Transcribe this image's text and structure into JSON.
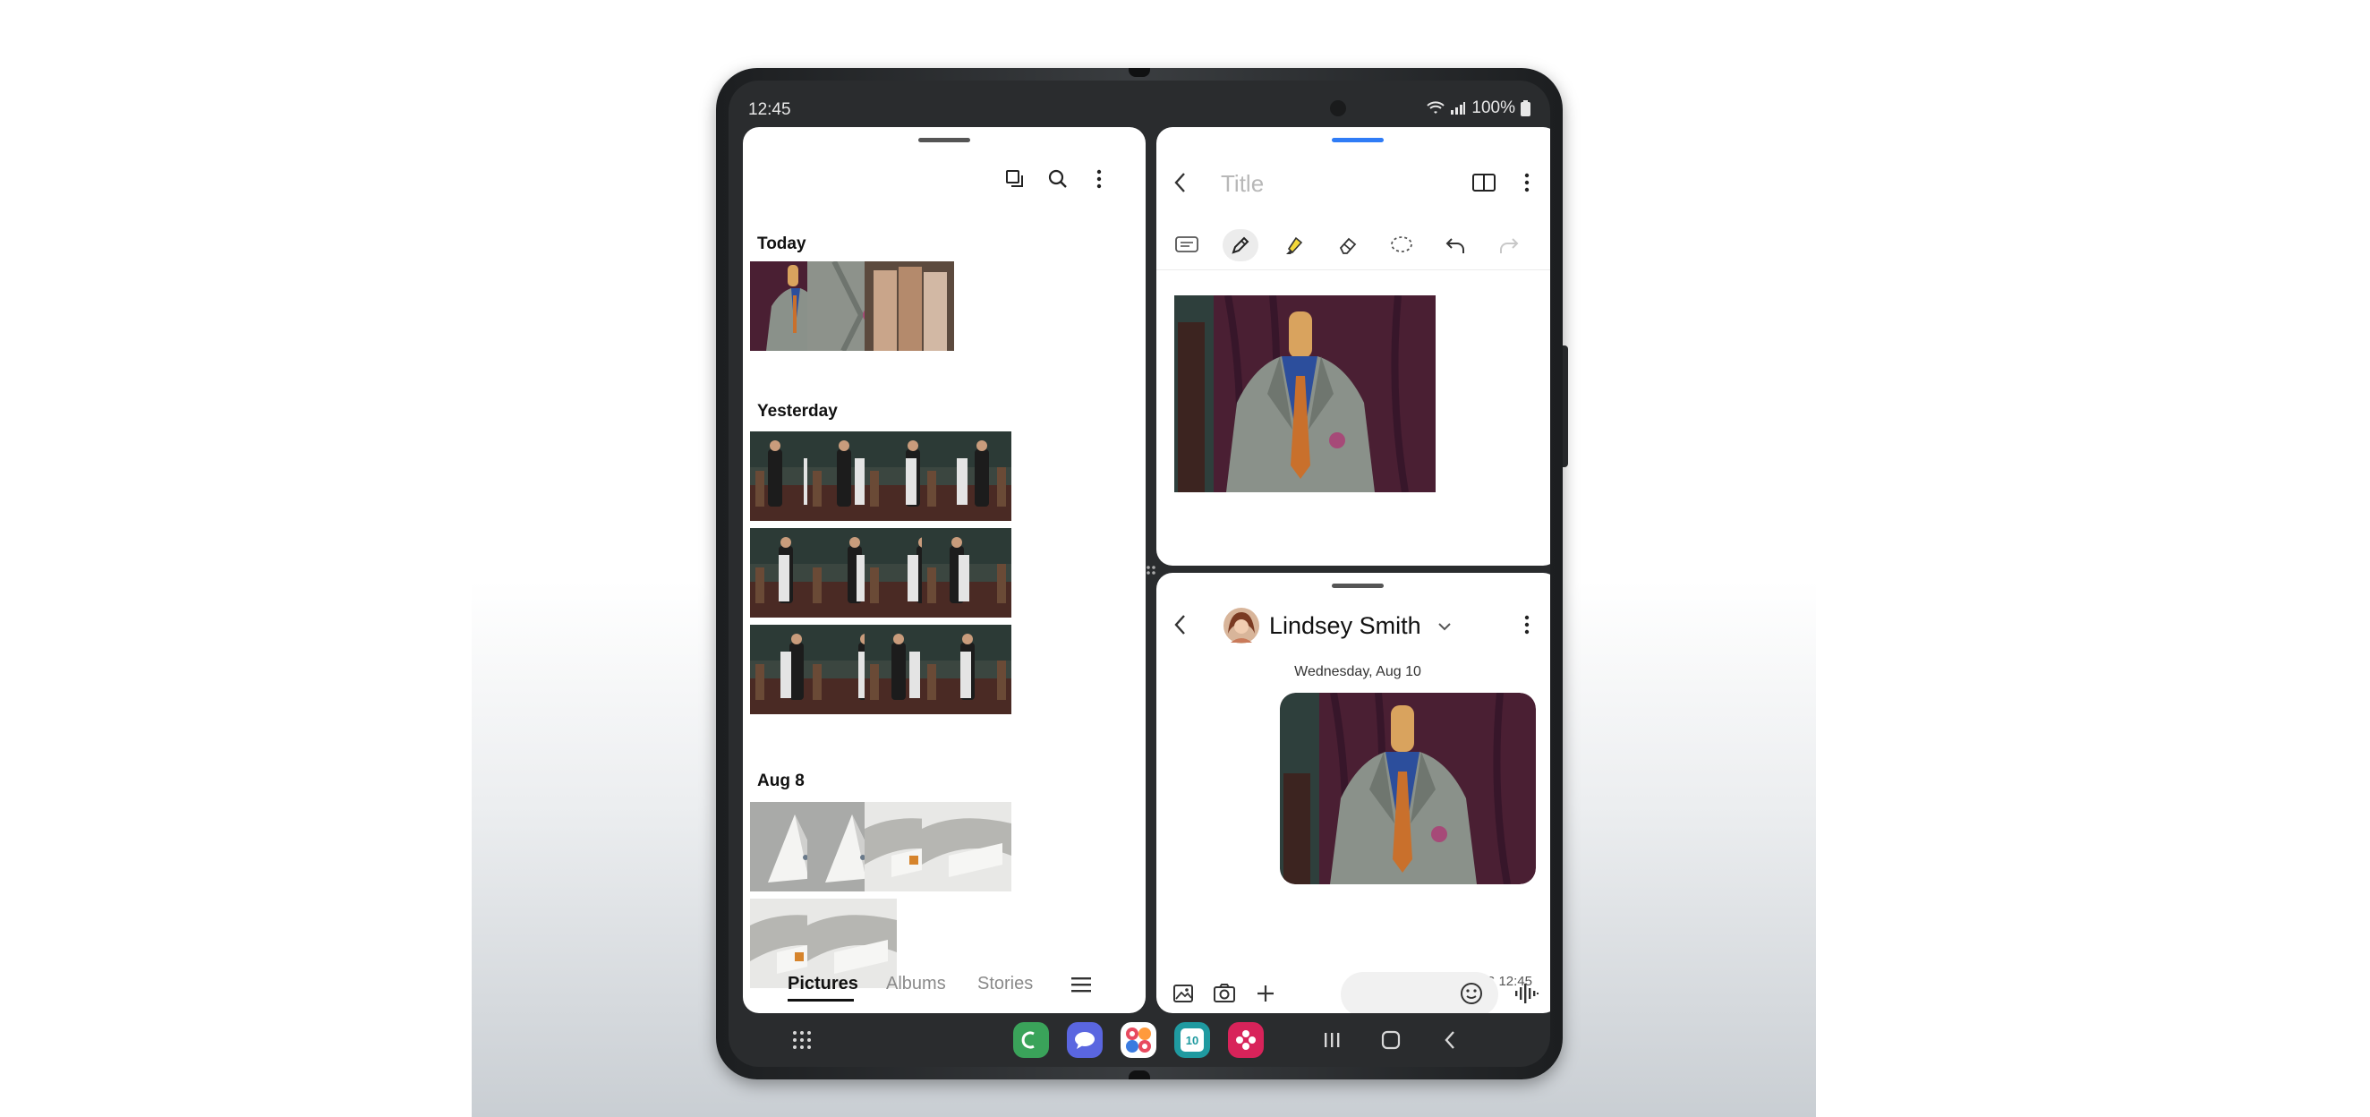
{
  "status_bar": {
    "time": "12:45",
    "battery": "100%",
    "icons": [
      "wifi-icon",
      "signal-icon",
      "battery-icon"
    ]
  },
  "gallery": {
    "toolbar_icons": [
      "select-copy-icon",
      "search-icon",
      "more-vertical-icon"
    ],
    "sections": [
      {
        "title": "Today",
        "count": 3,
        "theme": "suit-closeup"
      },
      {
        "title": "Yesterday",
        "count": 12,
        "theme": "tailor-shop"
      },
      {
        "title": "Aug 8",
        "count": 6,
        "theme": "shoes"
      }
    ],
    "tabs": [
      {
        "label": "Pictures",
        "active": true
      },
      {
        "label": "Albums",
        "active": false
      },
      {
        "label": "Stories",
        "active": false
      }
    ],
    "menu_icon": "menu-icon"
  },
  "notes": {
    "title_placeholder": "Title",
    "tools": [
      "text-box-icon",
      "pen-icon",
      "highlighter-icon",
      "eraser-icon",
      "lasso-icon",
      "undo-icon",
      "redo-icon"
    ],
    "selected_tool": "pen-icon"
  },
  "messages": {
    "contact": "Lindsey Smith",
    "date": "Wednesday, Aug 10",
    "meta": "MMS 12:45",
    "composer_icons": [
      "gallery-icon",
      "camera-icon",
      "add-icon",
      "emoji-icon",
      "voice-icon"
    ]
  },
  "navbar": {
    "dock_apps": [
      {
        "name": "phone",
        "color": "#3aa35a"
      },
      {
        "name": "messages",
        "color": "#5a66e0"
      },
      {
        "name": "social",
        "color": "#e84a5f"
      },
      {
        "name": "calendar",
        "color": "#1f9aa0"
      },
      {
        "name": "flower",
        "color": "#d8235a"
      }
    ],
    "calendar_day": "10"
  },
  "colors": {
    "accent_blue": "#2f7cf6",
    "frame": "#2a2c2e"
  }
}
